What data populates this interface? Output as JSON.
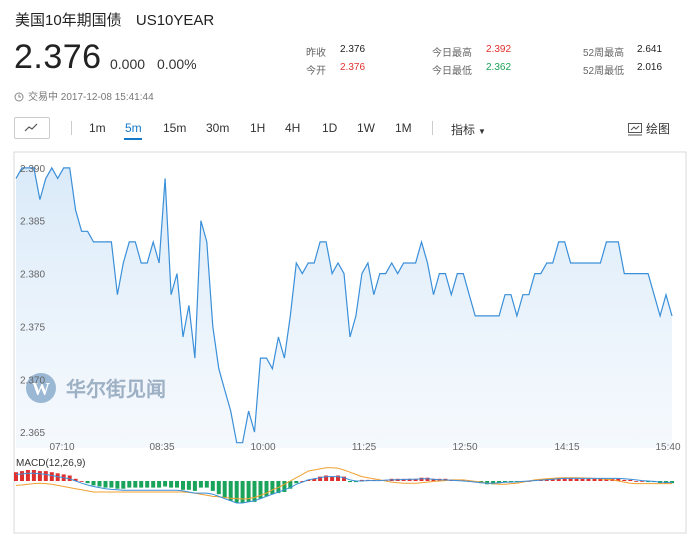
{
  "header": {
    "name": "美国10年期国债",
    "symbol": "US10YEAR",
    "price": "2.376",
    "change": "0.000",
    "change_pct": "0.00%",
    "status_time": "交易中 2017-12-08 15:41:44"
  },
  "stats": {
    "prev_close_label": "昨收",
    "prev_close": "2.376",
    "open_label": "今开",
    "open": "2.376",
    "high_label": "今日最高",
    "high": "2.392",
    "low_label": "今日最低",
    "low": "2.362",
    "wk52_high_label": "52周最高",
    "wk52_high": "2.641",
    "wk52_low_label": "52周最低",
    "wk52_low": "2.016"
  },
  "toolbar": {
    "intervals": [
      "1m",
      "5m",
      "15m",
      "30m",
      "1H",
      "4H",
      "1D",
      "1W",
      "1M"
    ],
    "active_interval": "5m",
    "indicator_label": "指标",
    "draw_label": "绘图"
  },
  "watermark": "华尔街见闻",
  "macd_label": "MACD(12,26,9)",
  "colors": {
    "line": "#3a8fd9",
    "up": "#e0302d",
    "down": "#1aa35a",
    "signal": "#f0a030"
  },
  "chart_data": {
    "type": "area",
    "x_ticks": [
      "07:10",
      "08:35",
      "10:00",
      "11:25",
      "12:50",
      "14:15",
      "15:40"
    ],
    "y_ticks": [
      "2.390",
      "2.385",
      "2.380",
      "2.375",
      "2.370",
      "2.365"
    ],
    "ylim": [
      2.3635,
      2.3915
    ],
    "values": [
      2.389,
      2.39,
      2.39,
      2.39,
      2.387,
      2.389,
      2.39,
      2.389,
      2.39,
      2.39,
      2.386,
      2.384,
      2.384,
      2.383,
      2.383,
      2.383,
      2.383,
      2.378,
      2.381,
      2.383,
      2.383,
      2.381,
      2.381,
      2.383,
      2.381,
      2.389,
      2.378,
      2.38,
      2.374,
      2.377,
      2.372,
      2.385,
      2.383,
      2.375,
      2.371,
      2.369,
      2.367,
      2.364,
      2.364,
      2.367,
      2.365,
      2.372,
      2.372,
      2.371,
      2.374,
      2.372,
      2.376,
      2.381,
      2.38,
      2.381,
      2.381,
      2.383,
      2.383,
      2.38,
      2.381,
      2.38,
      2.374,
      2.376,
      2.38,
      2.381,
      2.378,
      2.38,
      2.38,
      2.381,
      2.38,
      2.381,
      2.381,
      2.381,
      2.383,
      2.381,
      2.378,
      2.38,
      2.38,
      2.378,
      2.38,
      2.38,
      2.378,
      2.376,
      2.376,
      2.376,
      2.376,
      2.376,
      2.378,
      2.378,
      2.376,
      2.378,
      2.378,
      2.38,
      2.38,
      2.381,
      2.381,
      2.383,
      2.383,
      2.381,
      2.381,
      2.381,
      2.381,
      2.381,
      2.381,
      2.383,
      2.383,
      2.383,
      2.38,
      2.38,
      2.38,
      2.38,
      2.38,
      2.378,
      2.376,
      2.378,
      2.376
    ],
    "macd": {
      "label": "MACD(12,26,9)",
      "histogram": [
        0.4,
        0.45,
        0.5,
        0.5,
        0.45,
        0.45,
        0.4,
        0.35,
        0.3,
        0.25,
        0.1,
        0.0,
        -0.1,
        -0.2,
        -0.25,
        -0.3,
        -0.3,
        -0.35,
        -0.35,
        -0.3,
        -0.3,
        -0.3,
        -0.3,
        -0.3,
        -0.3,
        -0.25,
        -0.3,
        -0.3,
        -0.4,
        -0.4,
        -0.45,
        -0.3,
        -0.3,
        -0.45,
        -0.6,
        -0.75,
        -0.9,
        -1.0,
        -1.0,
        -0.95,
        -0.95,
        -0.8,
        -0.7,
        -0.6,
        -0.55,
        -0.5,
        -0.35,
        -0.1,
        0.0,
        0.05,
        0.1,
        0.2,
        0.25,
        0.2,
        0.25,
        0.2,
        -0.05,
        -0.05,
        0.05,
        0.05,
        0.05,
        0.05,
        0.05,
        0.1,
        0.1,
        0.1,
        0.1,
        0.1,
        0.15,
        0.15,
        0.1,
        0.1,
        0.1,
        0.05,
        0.05,
        0.05,
        0.0,
        -0.05,
        -0.1,
        -0.15,
        -0.15,
        -0.1,
        -0.05,
        -0.05,
        -0.05,
        0.0,
        0.0,
        0.05,
        0.05,
        0.1,
        0.1,
        0.15,
        0.15,
        0.15,
        0.1,
        0.1,
        0.1,
        0.1,
        0.1,
        0.1,
        0.1,
        0.1,
        0.05,
        0.05,
        0.0,
        0.0,
        -0.05,
        -0.05,
        -0.1,
        -0.1,
        -0.1
      ],
      "dif": [
        0.3,
        0.32,
        0.35,
        0.35,
        0.33,
        0.3,
        0.25,
        0.2,
        0.15,
        0.1,
        0.0,
        -0.1,
        -0.18,
        -0.25,
        -0.3,
        -0.35,
        -0.38,
        -0.4,
        -0.42,
        -0.42,
        -0.42,
        -0.42,
        -0.42,
        -0.42,
        -0.42,
        -0.42,
        -0.42,
        -0.42,
        -0.45,
        -0.5,
        -0.55,
        -0.55,
        -0.55,
        -0.6,
        -0.7,
        -0.8,
        -0.9,
        -1.0,
        -1.0,
        -0.95,
        -0.9,
        -0.8,
        -0.7,
        -0.6,
        -0.5,
        -0.4,
        -0.3,
        -0.15,
        -0.05,
        0.05,
        0.1,
        0.15,
        0.2,
        0.2,
        0.2,
        0.15,
        0.05,
        0.0,
        0.0,
        0.02,
        0.02,
        0.02,
        0.04,
        0.05,
        0.06,
        0.07,
        0.08,
        0.08,
        0.1,
        0.1,
        0.08,
        0.06,
        0.05,
        0.03,
        0.02,
        0.0,
        -0.02,
        -0.05,
        -0.08,
        -0.1,
        -0.1,
        -0.08,
        -0.06,
        -0.05,
        -0.04,
        -0.02,
        0.0,
        0.02,
        0.04,
        0.06,
        0.08,
        0.1,
        0.12,
        0.12,
        0.12,
        0.12,
        0.12,
        0.12,
        0.12,
        0.12,
        0.12,
        0.12,
        0.1,
        0.08,
        0.05,
        0.02,
        0.0,
        -0.02,
        -0.05,
        -0.06,
        -0.07
      ],
      "dea": [
        -0.2,
        -0.18,
        -0.15,
        -0.12,
        -0.1,
        -0.12,
        -0.15,
        -0.2,
        -0.25,
        -0.3,
        -0.35,
        -0.4,
        -0.45,
        -0.5,
        -0.5,
        -0.5,
        -0.5,
        -0.5,
        -0.5,
        -0.5,
        -0.5,
        -0.5,
        -0.5,
        -0.5,
        -0.5,
        -0.5,
        -0.5,
        -0.5,
        -0.5,
        -0.52,
        -0.55,
        -0.6,
        -0.65,
        -0.7,
        -0.72,
        -0.75,
        -0.78,
        -0.8,
        -0.82,
        -0.8,
        -0.75,
        -0.65,
        -0.55,
        -0.4,
        -0.3,
        -0.15,
        0.0,
        0.15,
        0.3,
        0.45,
        0.5,
        0.55,
        0.6,
        0.6,
        0.58,
        0.5,
        0.4,
        0.3,
        0.2,
        0.15,
        0.1,
        0.05,
        0.0,
        -0.05,
        -0.08,
        -0.1,
        -0.1,
        -0.1,
        -0.08,
        -0.05,
        -0.02,
        0.0,
        0.02,
        0.05,
        0.05,
        0.05,
        0.02,
        -0.02,
        -0.05,
        -0.1,
        -0.12,
        -0.15,
        -0.15,
        -0.12,
        -0.1,
        -0.05,
        0.0,
        0.05,
        0.08,
        0.1,
        0.12,
        0.14,
        0.15,
        0.15,
        0.15,
        0.14,
        0.13,
        0.12,
        0.1,
        0.08,
        0.05,
        0.0,
        -0.05,
        -0.1,
        -0.12,
        -0.12,
        -0.12,
        -0.12,
        -0.12,
        -0.12,
        -0.12
      ]
    }
  }
}
